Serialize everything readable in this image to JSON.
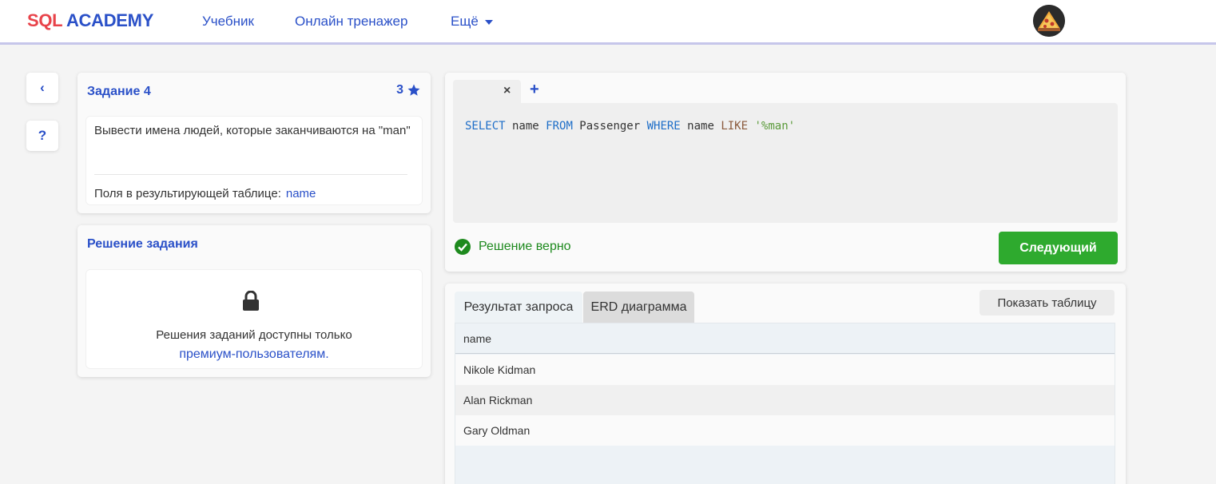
{
  "header": {
    "logo_part1": "SQL",
    "logo_part2": "ACADEMY",
    "nav": [
      "Учебник",
      "Онлайн тренажер",
      "Ещё"
    ]
  },
  "sidebar": {
    "back_label": "‹",
    "help_label": "?"
  },
  "task": {
    "title": "Задание 4",
    "stars": "3",
    "description": "Вывести имена людей, которые заканчиваются на \"man\"",
    "fields_label": "Поля в результирующей таблице:",
    "fields_value": "name"
  },
  "solution": {
    "title": "Решение задания",
    "locked_text": "Решения заданий доступны только",
    "premium_link": "премиум-пользователям."
  },
  "editor": {
    "tab_close": "×",
    "tab_add": "+",
    "code": {
      "t1": "SELECT",
      "t2": " name ",
      "t3": "FROM",
      "t4": " Passenger ",
      "t5": "WHERE",
      "t6": " name ",
      "t7": "LIKE",
      "t8": " ",
      "t9": "'%man'"
    },
    "status": "Решение верно",
    "next_button": "Следующий"
  },
  "results": {
    "tab_result": "Результат запроса",
    "tab_erd": "ERD диаграмма",
    "show_table": "Показать таблицу",
    "column": "name",
    "rows": [
      "Nikole Kidman",
      "Alan Rickman",
      "Gary Oldman"
    ]
  },
  "colors": {
    "brand_blue": "#2a50c8",
    "logo_red": "#e8434a",
    "success_green": "#2eaa2e"
  }
}
